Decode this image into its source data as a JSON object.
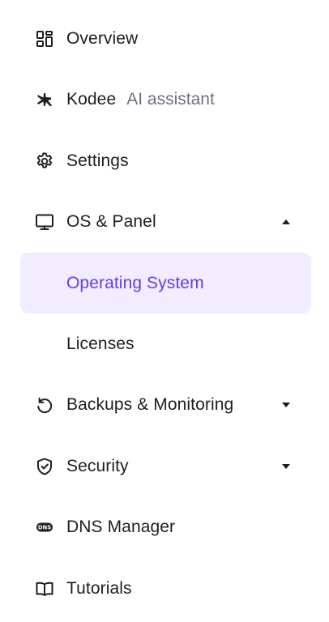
{
  "colors": {
    "text": "#1d1e20",
    "muted": "#6d7081",
    "accent": "#673de6",
    "active_bg": "#f1ecfe"
  },
  "menu": {
    "overview": {
      "label": "Overview",
      "icon": "grid-icon"
    },
    "kodee": {
      "label": "Kodee",
      "sub_label": "AI assistant",
      "icon": "sparkle-icon"
    },
    "settings": {
      "label": "Settings",
      "icon": "gear-icon"
    },
    "os_panel": {
      "label": "OS & Panel",
      "icon": "monitor-icon",
      "expanded": true,
      "children": {
        "operating_system": {
          "label": "Operating System",
          "active": true
        },
        "licenses": {
          "label": "Licenses"
        }
      }
    },
    "backups": {
      "label": "Backups & Monitoring",
      "icon": "restore-icon",
      "expanded": false
    },
    "security": {
      "label": "Security",
      "icon": "shield-check-icon",
      "expanded": false
    },
    "dns": {
      "label": "DNS Manager",
      "icon": "dns-icon",
      "icon_text": "DNS"
    },
    "tutorials": {
      "label": "Tutorials",
      "icon": "book-icon"
    }
  }
}
